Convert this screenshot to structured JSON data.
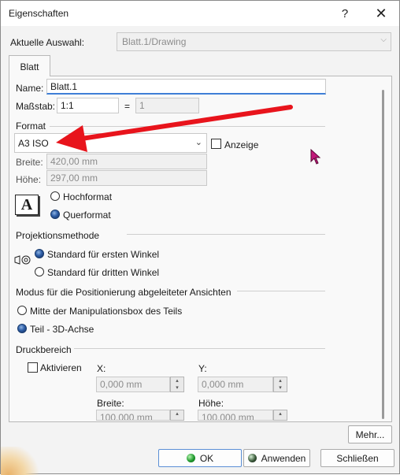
{
  "window": {
    "title": "Eigenschaften",
    "help_glyph": "?",
    "close_glyph": "✕"
  },
  "selection": {
    "label": "Aktuelle Auswahl:",
    "value": "Blatt.1/Drawing"
  },
  "tabs": [
    {
      "label": "Blatt"
    }
  ],
  "sheet": {
    "name_label": "Name:",
    "name_value": "Blatt.1",
    "scale_label": "Maßstab:",
    "scale_value": "1:1",
    "equals": "=",
    "scale_result": "1",
    "format_section": "Format",
    "format_value": "A3 ISO",
    "display_label": "Anzeige",
    "width_label": "Breite:",
    "width_value": "420,00 mm",
    "height_label": "Höhe:",
    "height_value": "297,00 mm",
    "orientation_icon_text": "A",
    "portrait_label": "Hochformat",
    "landscape_label": "Querformat",
    "orientation_selected": "Querformat"
  },
  "projection": {
    "section": "Projektionsmethode",
    "first_angle": "Standard für ersten Winkel",
    "third_angle": "Standard für dritten Winkel",
    "selected": "Standard für ersten Winkel"
  },
  "positioning": {
    "section": "Modus für die Positionierung abgeleiteter Ansichten",
    "center_box": "Mitte der Manipulationsbox des Teils",
    "axis": "Teil - 3D-Achse",
    "selected": "Teil - 3D-Achse"
  },
  "print_area": {
    "section": "Druckbereich",
    "activate_label": "Aktivieren",
    "x_label": "X:",
    "x_value": "0,000 mm",
    "y_label": "Y:",
    "y_value": "0,000 mm",
    "width_label": "Breite:",
    "width_value": "100,000 mm",
    "height_label": "Höhe:",
    "height_value": "100,000 mm"
  },
  "buttons": {
    "more": "Mehr...",
    "ok": "OK",
    "apply": "Anwenden",
    "close": "Schließen"
  },
  "colors": {
    "annotation_arrow": "#e8141c",
    "accent_focus": "#3f7fd7",
    "cursor": "#c2187a"
  },
  "icons": [
    "help-icon",
    "close-icon",
    "chevron-down-icon",
    "orientation-a-icon",
    "projection-symbol-icon",
    "spin-up-icon",
    "spin-down-icon",
    "mouse-cursor-icon"
  ]
}
